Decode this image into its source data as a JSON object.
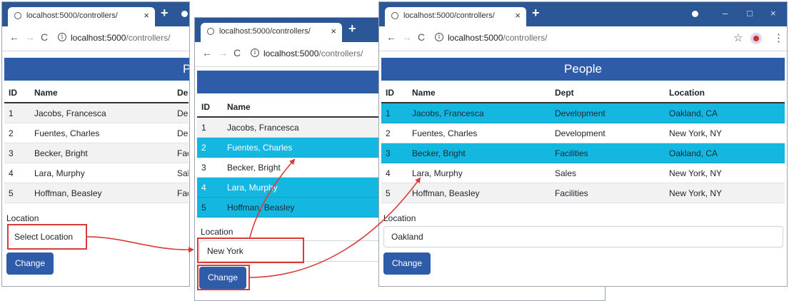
{
  "browser": {
    "tab_title": "localhost:5000/controllers/",
    "close_glyph": "×",
    "new_tab_glyph": "+",
    "minimize_glyph": "–",
    "maximize_glyph": "□",
    "close_window_glyph": "×",
    "host": "localhost:5000",
    "path": "/controllers/",
    "back_glyph": "←",
    "forward_glyph": "→",
    "reload_glyph": "C",
    "info_glyph": "i",
    "star_glyph": "☆",
    "menu_glyph": "⋮"
  },
  "page": {
    "heading": "People",
    "heading_cut": "P",
    "columns": {
      "id": "ID",
      "name": "Name",
      "dept": "Dept",
      "location": "Location",
      "dept_cut": "De"
    },
    "rows": [
      {
        "id": "1",
        "name": "Jacobs, Francesca",
        "dept": "Development",
        "location": "Oakland, CA",
        "dept_cut": "De",
        "dept_cut2": "D"
      },
      {
        "id": "2",
        "name": "Fuentes, Charles",
        "dept": "Development",
        "location": "New York, NY",
        "dept_cut": "De",
        "dept_cut2": "D"
      },
      {
        "id": "3",
        "name": "Becker, Bright",
        "dept": "Facilities",
        "location": "Oakland, CA",
        "dept_cut": "Fac",
        "dept_cut2": "F"
      },
      {
        "id": "4",
        "name": "Lara, Murphy",
        "dept": "Sales",
        "location": "New York, NY",
        "dept_cut": "Sal",
        "dept_cut2": "S"
      },
      {
        "id": "5",
        "name": "Hoffman, Beasley",
        "dept": "Facilities",
        "location": "New York, NY",
        "dept_cut": "Fac",
        "dept_cut2": "F"
      }
    ],
    "location_label": "Location",
    "change_label": "Change"
  },
  "windows": {
    "first": {
      "location_value": "Select Location"
    },
    "second": {
      "location_value": "New York",
      "highlighted_ids": [
        "2",
        "4",
        "5"
      ]
    },
    "third": {
      "location_value": "Oakland",
      "highlighted_ids": [
        "1",
        "3"
      ]
    }
  },
  "colors": {
    "titlebar": "#2b5797",
    "banner": "#2f5ca8",
    "highlight_row": "#13b7e0",
    "annotation": "#d93b3b"
  }
}
